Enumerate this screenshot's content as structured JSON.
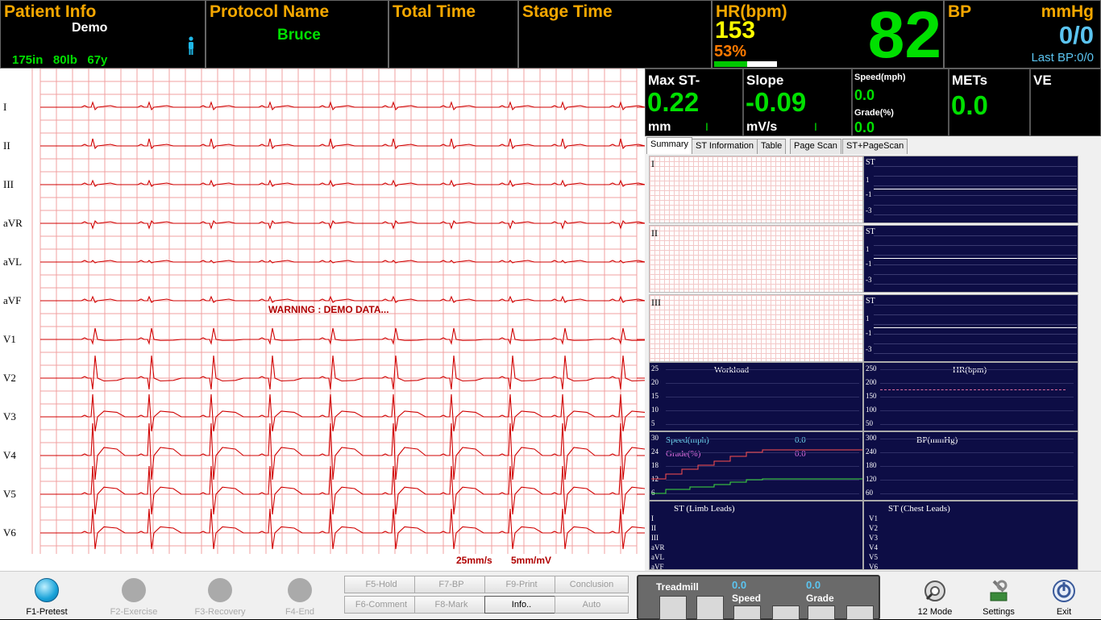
{
  "patient": {
    "title": "Patient Info",
    "name": "Demo",
    "stats": "175in   80lb   67y"
  },
  "protocol": {
    "title": "Protocol Name",
    "value": "Bruce"
  },
  "total_time": {
    "title": "Total Time"
  },
  "stage_time": {
    "title": "Stage Time"
  },
  "hr": {
    "title": "HR(bpm)",
    "target": "153",
    "percent": "53%",
    "value": "82",
    "progress": 0.53
  },
  "bp": {
    "title": "BP",
    "unit": "mmHg",
    "value": "0/0",
    "last": "Last BP:0/0"
  },
  "stats": {
    "max_st": {
      "label": "Max ST-",
      "value": "0.22",
      "unit": "mm",
      "lead": "I"
    },
    "slope": {
      "label": "Slope",
      "value": "-0.09",
      "unit": "mV/s",
      "lead": "I"
    },
    "speed": {
      "label": "Speed(mph)",
      "value": "0.0"
    },
    "grade": {
      "label": "Grade(%)",
      "value": "0.0"
    },
    "mets": {
      "label": "METs",
      "value": "0.0"
    },
    "ve": {
      "label": "VE"
    }
  },
  "tabs": [
    "Summary",
    "ST Information",
    "Table",
    "Page Scan",
    "ST+PageScan"
  ],
  "ecg": {
    "leads": [
      "I",
      "II",
      "III",
      "aVR",
      "aVL",
      "aVF",
      "V1",
      "V2",
      "V3",
      "V4",
      "V5",
      "V6"
    ],
    "warning": "WARNING : DEMO DATA...",
    "speed": "25mm/s",
    "gain": "5mm/mV",
    "color": "#d00000",
    "grid_color": "#f0a0a0"
  },
  "summary": {
    "st_leads": [
      "I",
      "II",
      "III"
    ],
    "st_label": "ST",
    "st_ticks": [
      "1",
      "-1",
      "-3"
    ],
    "workload": {
      "title": "Workload",
      "ticks": [
        "25",
        "20",
        "15",
        "10",
        "5"
      ]
    },
    "hr_chart": {
      "title": "HR(bpm)",
      "ticks": [
        "250",
        "200",
        "150",
        "100",
        "50"
      ]
    },
    "speed_grade": {
      "speed_label": "Speed(mph)",
      "speed_value": "0.0",
      "grade_label": "Grade(%)",
      "grade_value": "0.0",
      "ticks": [
        "30",
        "24",
        "18",
        "12",
        "6"
      ]
    },
    "bp_chart": {
      "title": "BP(mmHg)",
      "ticks": [
        "300",
        "240",
        "180",
        "120",
        "60"
      ]
    },
    "st_limb": {
      "title": "ST (Limb Leads)",
      "leads": [
        "I",
        "II",
        "III",
        "aVR",
        "aVL",
        "aVF"
      ]
    },
    "st_chest": {
      "title": "ST (Chest Leads)",
      "leads": [
        "V1",
        "V2",
        "V3",
        "V4",
        "V5",
        "V6"
      ]
    }
  },
  "toolbar": {
    "f1": "F1-Pretest",
    "f2": "F2-Exercise",
    "f3": "F3-Recovery",
    "f4": "F4-End",
    "f5": "F5-Hold",
    "f7": "F7-BP",
    "f9": "F9-Print",
    "conclusion": "Conclusion",
    "f6": "F6-Comment",
    "f8": "F8-Mark",
    "info": "Info..",
    "auto": "Auto",
    "treadmill": "Treadmill",
    "speed_value": "0.0",
    "speed_label": "Speed",
    "grade_value": "0.0",
    "grade_label": "Grade",
    "mode": "12 Mode",
    "settings": "Settings",
    "exit": "Exit"
  }
}
